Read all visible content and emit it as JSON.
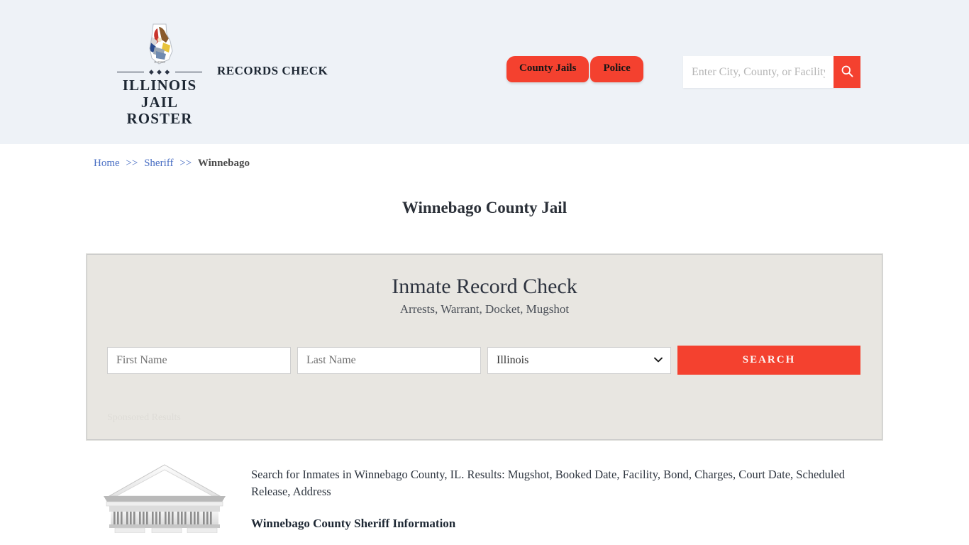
{
  "header": {
    "logo": {
      "state_icon": "illinois-state-outline-icon",
      "divider_dots": "◆ ◆ ◆",
      "line1": "ILLINOIS",
      "line2": "JAIL ROSTER"
    },
    "tagline": "RECORDS CHECK",
    "nav": [
      {
        "label": "County Jails",
        "name": "nav-tab-county-jails"
      },
      {
        "label": "Police",
        "name": "nav-tab-police"
      }
    ],
    "search": {
      "placeholder": "Enter City, County, or Facility",
      "value": "",
      "button_icon": "search-icon"
    }
  },
  "breadcrumb": {
    "items": [
      {
        "label": "Home",
        "is_link": true
      },
      {
        "label": "Sheriff",
        "is_link": true
      },
      {
        "label": "Winnebago",
        "is_link": false
      }
    ],
    "separator": ">>"
  },
  "page_title": "Winnebago County Jail",
  "record_panel": {
    "title": "Inmate Record Check",
    "subtitle": "Arrests, Warrant, Docket, Mugshot",
    "first_name_placeholder": "First Name",
    "first_name_value": "",
    "last_name_placeholder": "Last Name",
    "last_name_value": "",
    "state_selected": "Illinois",
    "state_options": [
      "Illinois"
    ],
    "chevron_icon": "chevron-down-icon",
    "search_button": "SEARCH",
    "sponsored_label": "Sponsored Results"
  },
  "bottom": {
    "image_icon": "courthouse-illustration",
    "description": "Search for Inmates in Winnebago County, IL. Results: Mugshot, Booked Date, Facility, Bond, Charges, Court Date, Scheduled Release, Address",
    "heading": "Winnebago County Sheriff Information"
  },
  "colors": {
    "accent_red": "#f4412f",
    "header_bg": "#eef2f7",
    "panel_bg": "#e8e6e1",
    "link_blue": "#4a6fc4"
  }
}
